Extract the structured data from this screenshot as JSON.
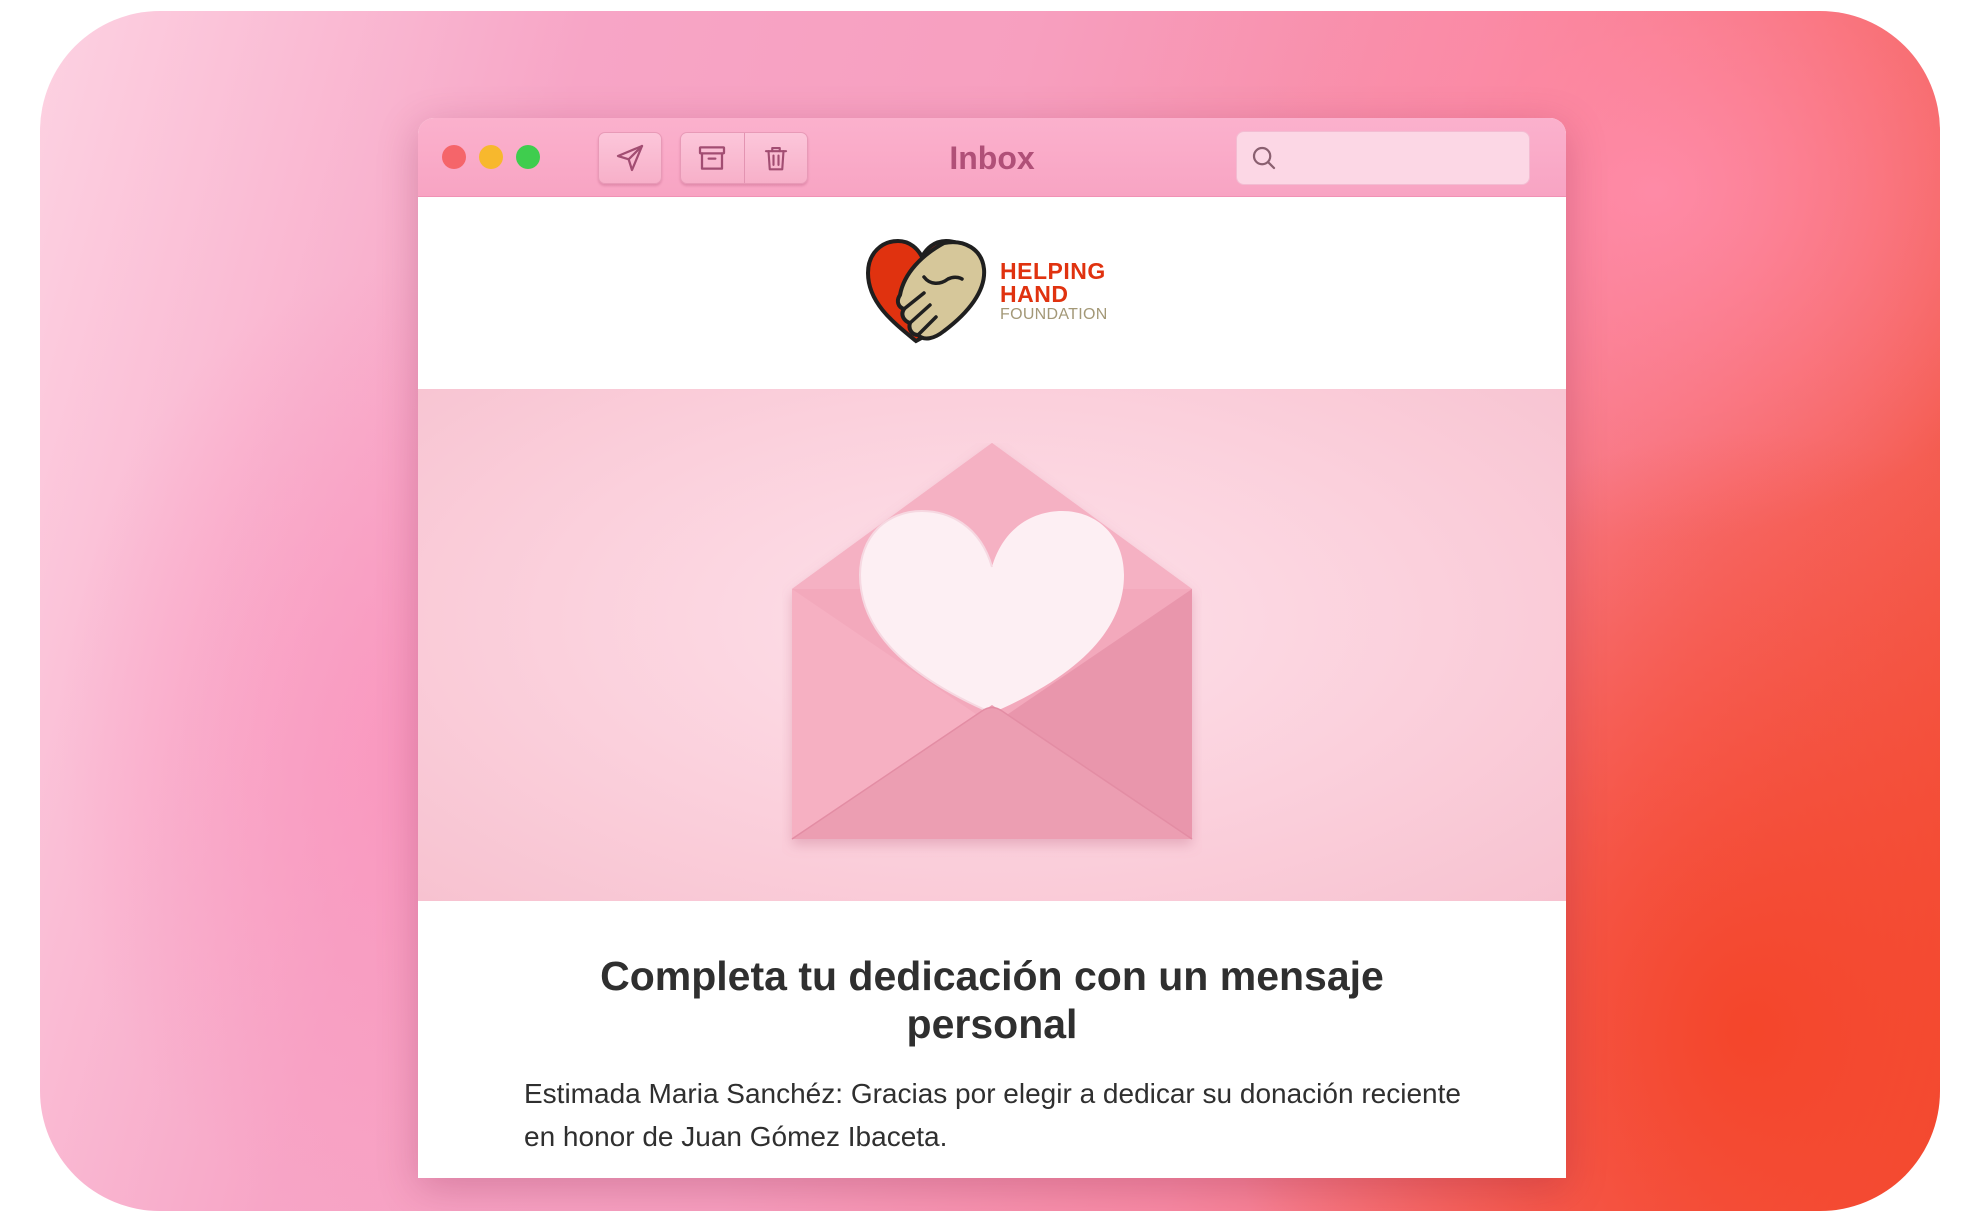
{
  "window": {
    "title": "Inbox",
    "search_placeholder": ""
  },
  "toolbar": {
    "icons": [
      "send-icon",
      "archive-icon",
      "trash-icon",
      "search-icon"
    ]
  },
  "email": {
    "logo": {
      "line1": "HELPING",
      "line2": "HAND",
      "line3": "FOUNDATION"
    },
    "headline": "Completa tu dedicación con un mensaje personal",
    "body": "Estimada Maria Sanchéz: Gracias por elegir a dedicar su donación reciente en honor de Juan Gómez Ibaceta."
  },
  "colors": {
    "titlebar": "#f8a4c3",
    "logo_red": "#e0320f",
    "logo_tan": "#a39877",
    "hero_bg": "#fbd0dc",
    "envelope": "#f3a9bc"
  }
}
